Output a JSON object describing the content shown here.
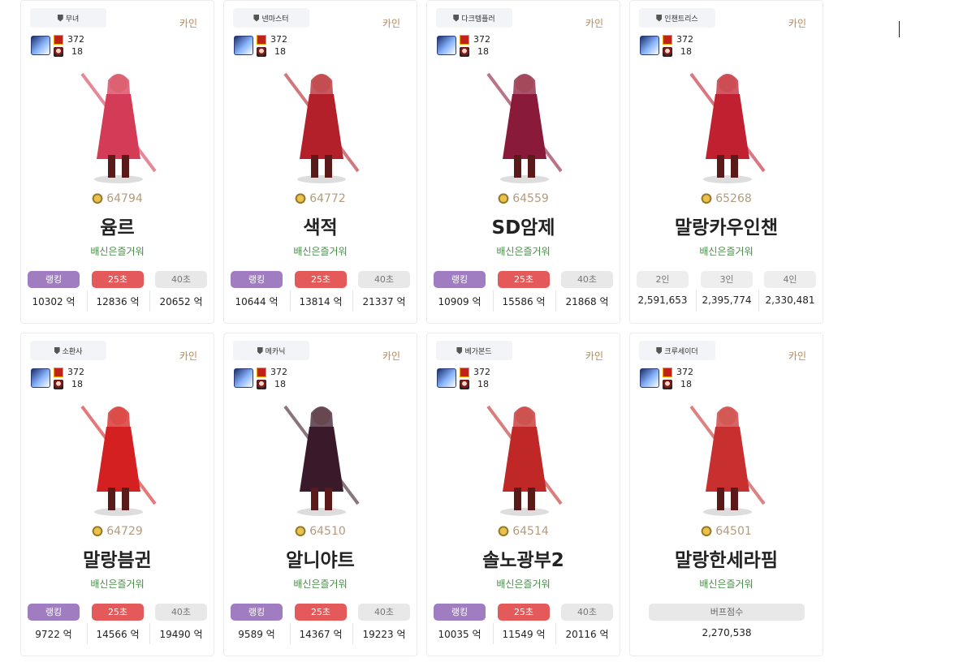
{
  "cards": [
    {
      "job": "무녀",
      "server": "카인",
      "level": "372",
      "buff_level": "18",
      "fame": "64794",
      "name": "윰르",
      "guild": "배신은즐거워",
      "buttons": [
        "랭킹",
        "25초",
        "40초"
      ],
      "values": [
        "10302 억",
        "12836 억",
        "20652 억"
      ],
      "art": "pink scythe priestess",
      "art_color": "#d43b56"
    },
    {
      "job": "넨마스터",
      "server": "카인",
      "level": "372",
      "buff_level": "18",
      "fame": "64772",
      "name": "색적",
      "guild": "배신은즐거워",
      "buttons": [
        "랭킹",
        "25초",
        "40초"
      ],
      "values": [
        "10644 억",
        "13814 억",
        "21337 억"
      ],
      "art": "red flame fighter",
      "art_color": "#b3202a"
    },
    {
      "job": "다크템플러",
      "server": "카인",
      "level": "372",
      "buff_level": "18",
      "fame": "64559",
      "name": "SD암제",
      "guild": "배신은즐거워",
      "buttons": [
        "랭킹",
        "25초",
        "40초"
      ],
      "values": [
        "10909 억",
        "15586 억",
        "21868 억"
      ],
      "art": "dark templar sword",
      "art_color": "#8a1a3a"
    },
    {
      "job": "인챈트리스",
      "server": "카인",
      "level": "372",
      "buff_level": "18",
      "fame": "65268",
      "name": "말랑카우인챈",
      "guild": "배신은즐거워",
      "buttons": [
        "2인",
        "3인",
        "4인"
      ],
      "values": [
        "2,591,653",
        "2,395,774",
        "2,330,481"
      ],
      "art": "enchantress moon staff",
      "art_color": "#c02030"
    },
    {
      "job": "소환사",
      "server": "카인",
      "level": "372",
      "buff_level": "18",
      "fame": "64729",
      "name": "말랑븜귄",
      "guild": "배신은즐거워",
      "buttons": [
        "랭킹",
        "25초",
        "40초"
      ],
      "values": [
        "9722 억",
        "14566 억",
        "19490 억"
      ],
      "art": "penguin costume summoner",
      "art_color": "#d42020"
    },
    {
      "job": "메카닉",
      "server": "카인",
      "level": "372",
      "buff_level": "18",
      "fame": "64510",
      "name": "알니야트",
      "guild": "배신은즐거워",
      "buttons": [
        "랭킹",
        "25초",
        "40초"
      ],
      "values": [
        "9589 억",
        "14367 억",
        "19223 억"
      ],
      "art": "mechanic gown bird",
      "art_color": "#3a1a2a"
    },
    {
      "job": "베가본드",
      "server": "카인",
      "level": "372",
      "buff_level": "18",
      "fame": "64514",
      "name": "솔노광부2",
      "guild": "배신은즐거워",
      "buttons": [
        "랭킹",
        "25초",
        "40초"
      ],
      "values": [
        "10035 억",
        "11549 억",
        "20116 억"
      ],
      "art": "vagabond katana",
      "art_color": "#c02828"
    },
    {
      "job": "크루세이더",
      "server": "카인",
      "level": "372",
      "buff_level": "18",
      "fame": "64501",
      "name": "말랑한세라핌",
      "guild": "배신은즐거워",
      "buttons": [
        "버프점수"
      ],
      "values": [
        "2,270,538"
      ],
      "art": "crusader staff",
      "art_color": "#c83030"
    }
  ]
}
